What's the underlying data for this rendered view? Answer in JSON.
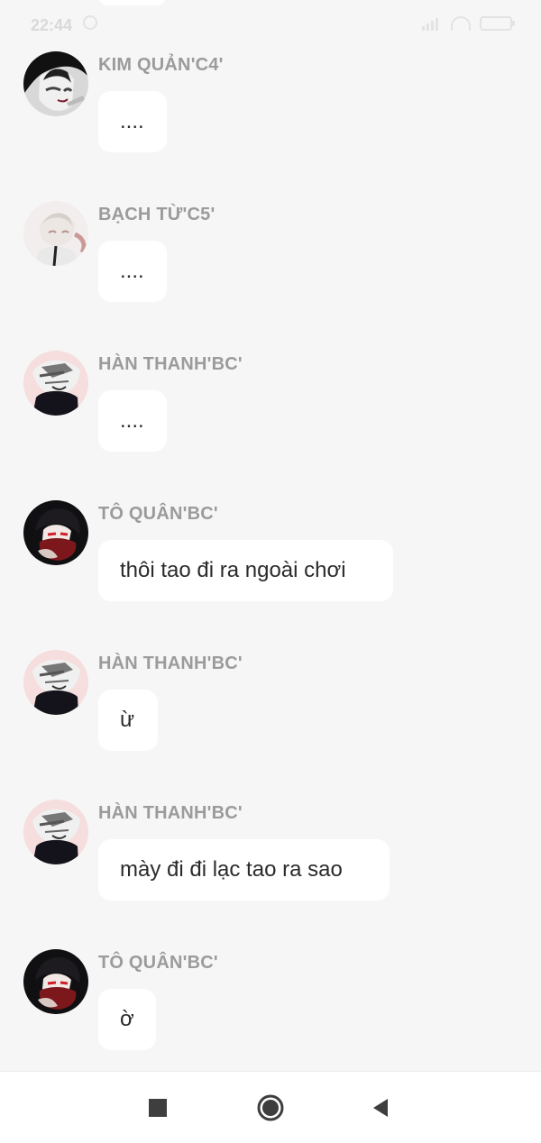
{
  "status_bar": {
    "time": "22:44"
  },
  "messages": [
    {
      "sender": "KIM QUẢN'C4'",
      "text": "....",
      "avatar_icon": "dark-hair-character-avatar"
    },
    {
      "sender": "BẠCH TỪ'C5'",
      "text": "....",
      "avatar_icon": "light-hair-character-avatar"
    },
    {
      "sender": "HÀN THANH'BC'",
      "text": "....",
      "avatar_icon": "masked-character-avatar"
    },
    {
      "sender": "TÔ QUÂN'BC'",
      "text": "thôi tao đi ra ngoài chơi",
      "avatar_icon": "red-scarf-character-avatar"
    },
    {
      "sender": "HÀN THANH'BC'",
      "text": "ừ",
      "avatar_icon": "masked-character-avatar"
    },
    {
      "sender": "HÀN THANH'BC'",
      "text": "mày đi đi lạc tao ra sao",
      "avatar_icon": "masked-character-avatar"
    },
    {
      "sender": "TÔ QUÂN'BC'",
      "text": "ờ",
      "avatar_icon": "red-scarf-character-avatar"
    }
  ],
  "nav_bar": {
    "icons": [
      "recent-apps-icon",
      "home-icon",
      "back-icon"
    ]
  },
  "colors": {
    "background": "#f6f6f6",
    "bubble": "#ffffff",
    "sender_text": "#9b9b9b",
    "message_text": "#2b2b2b"
  }
}
